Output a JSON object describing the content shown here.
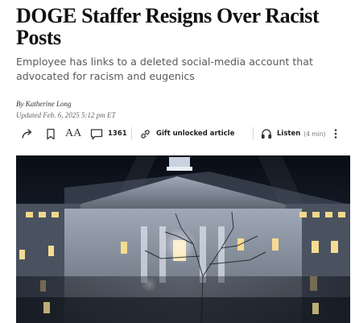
{
  "article": {
    "headline": "DOGE Staffer Resigns Over Racist Posts",
    "dek": "Employee has links to a deleted social-media account that advocated for racism and eugenics",
    "byline_prefix": "By ",
    "author": "Katherine Long",
    "updated": "Updated Feb. 6, 2025 5:12 pm ET"
  },
  "toolbar": {
    "font_size_label": "AA",
    "comment_count": "1361",
    "gift_label": "Gift unlocked article",
    "listen_label": "Listen",
    "listen_duration": "(4 min)",
    "icons": [
      "share-icon",
      "bookmark-icon",
      "font-size-icon",
      "comment-icon",
      "gift-link-icon",
      "headphones-icon",
      "more-icon"
    ]
  },
  "colors": {
    "text": "#111111",
    "dek": "#5a5a5a",
    "photo_sky": "#0c111a"
  }
}
